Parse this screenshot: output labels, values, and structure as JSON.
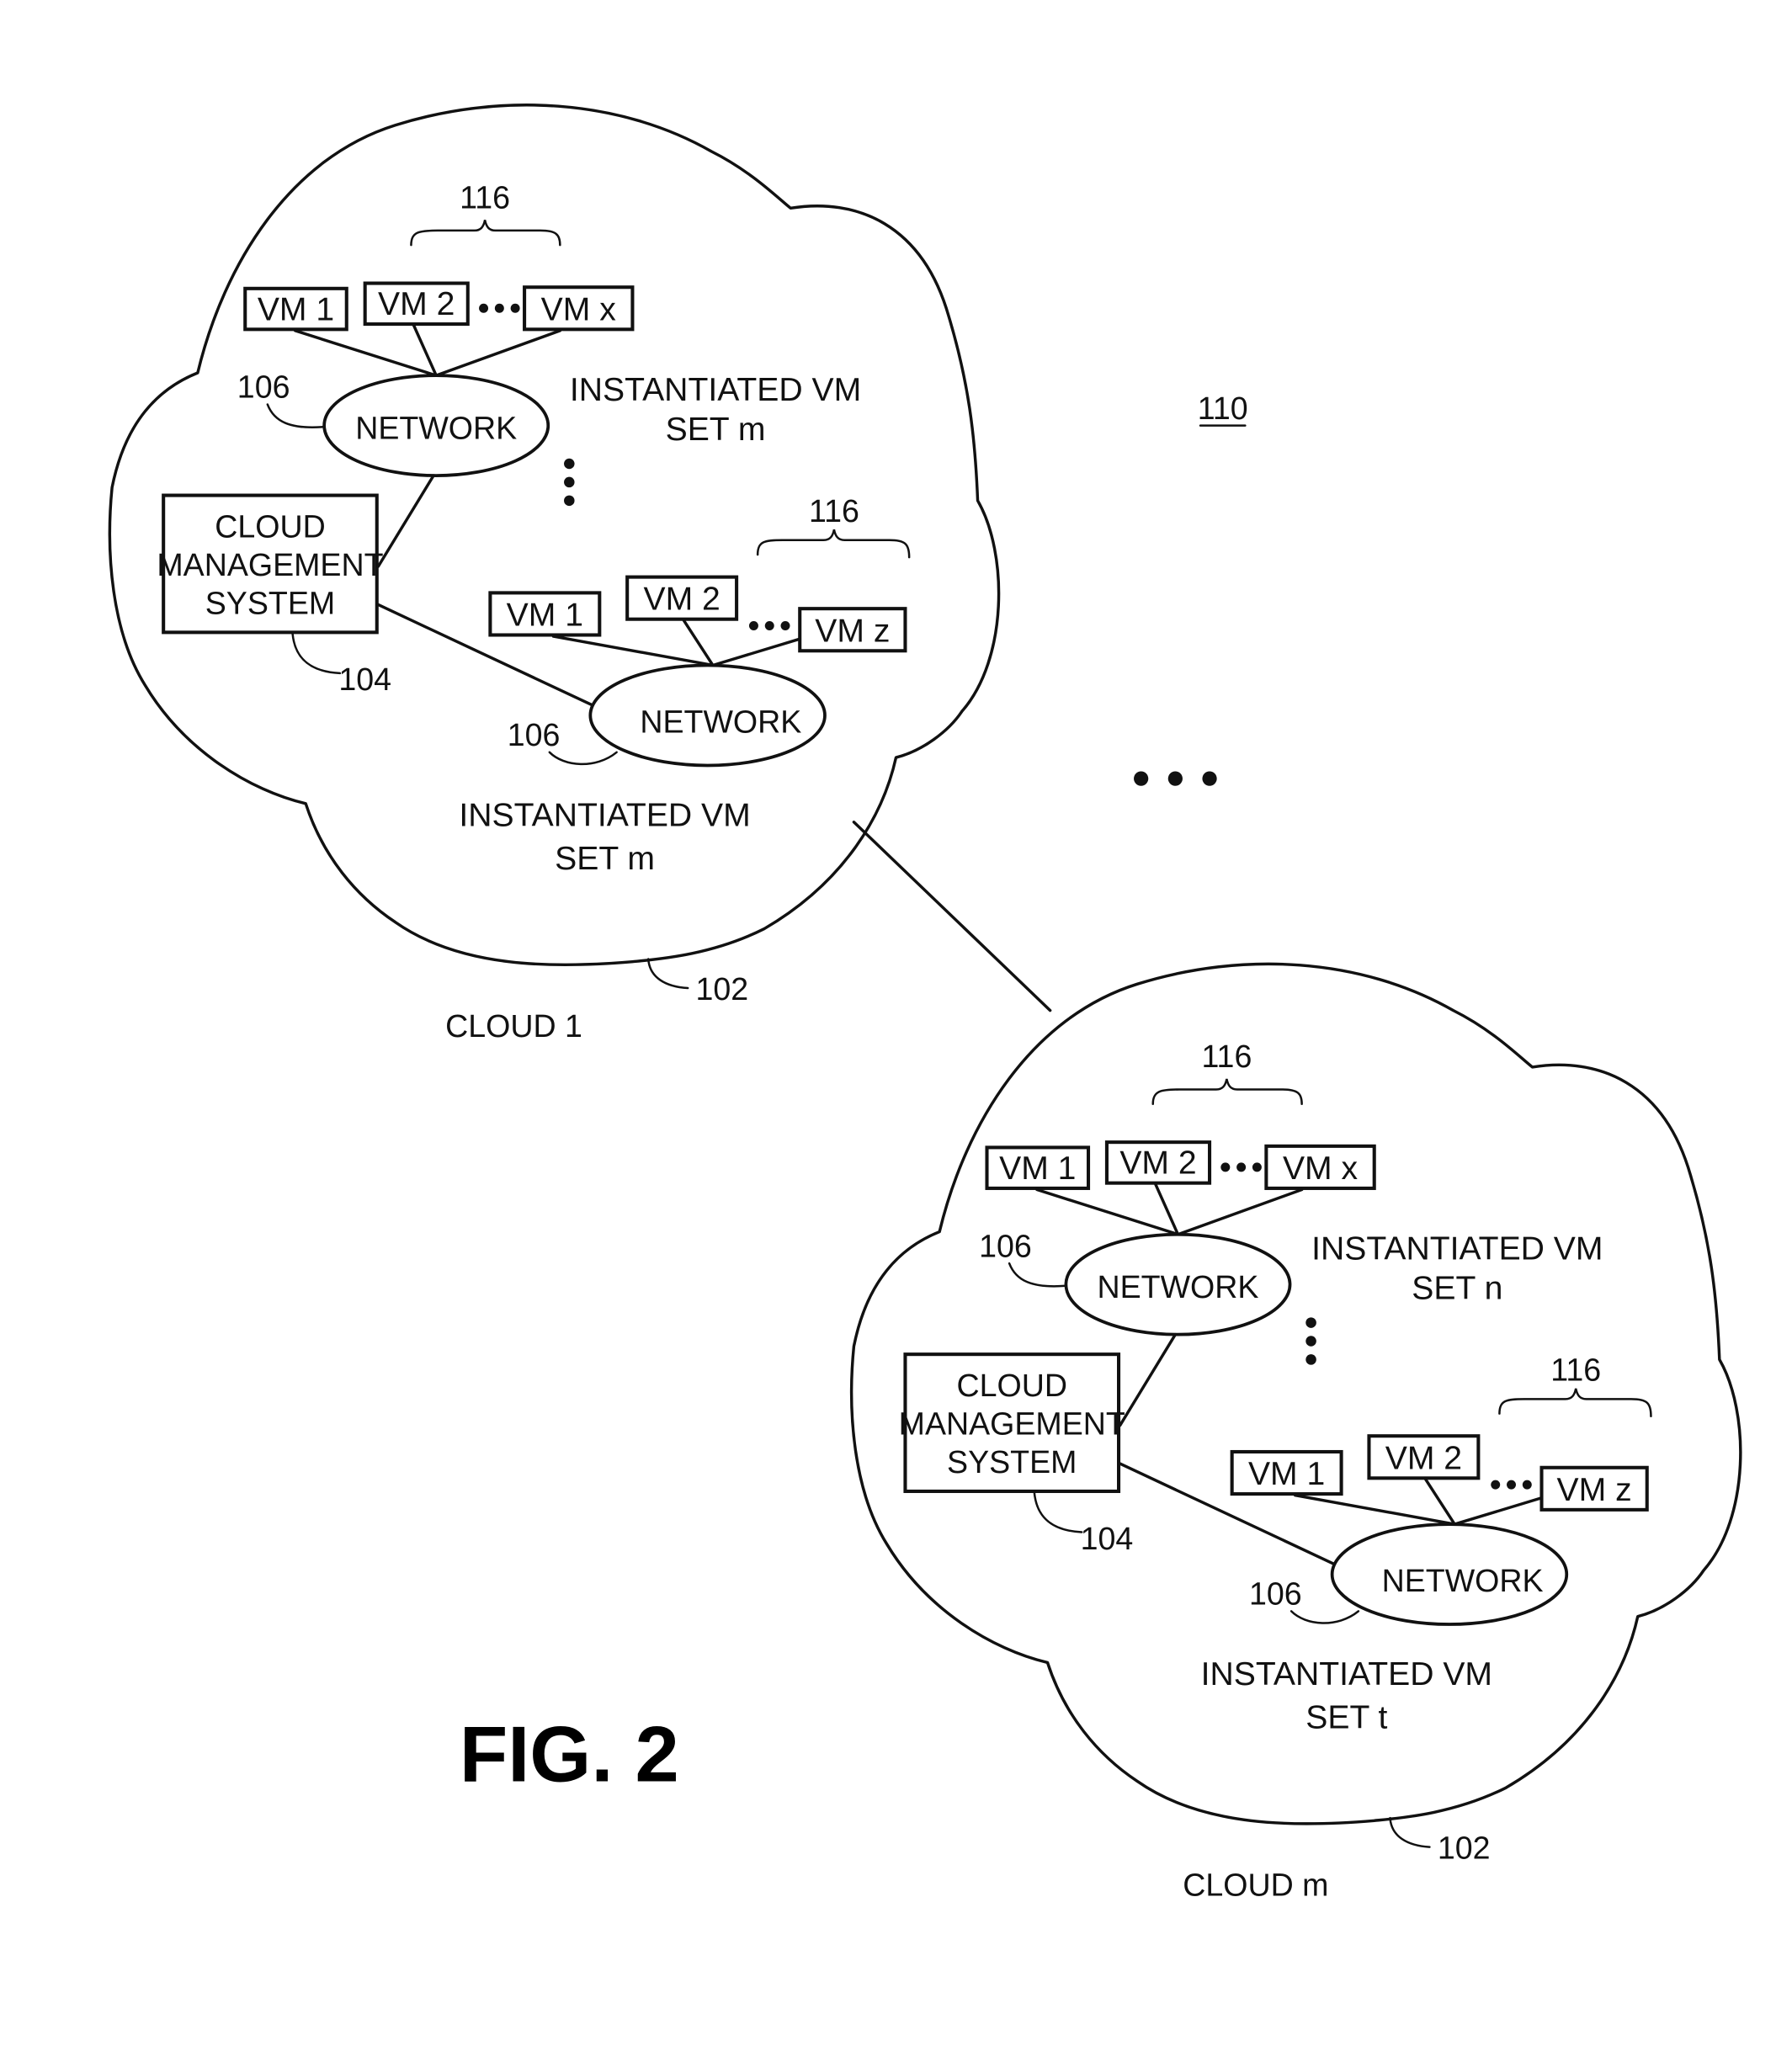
{
  "figure": {
    "label": "FIG. 2",
    "system_ref": "110",
    "connector_ellipsis": "• • •"
  },
  "clouds": [
    {
      "name": "CLOUD 1",
      "ref": "102",
      "cms": {
        "lines": [
          "CLOUD",
          "MANAGEMENT",
          "SYSTEM"
        ],
        "ref": "104"
      },
      "vm_sets": [
        {
          "set_label_line1": "INSTANTIATED VM",
          "set_label_line2": "SET m",
          "network_label": "NETWORK",
          "network_ref": "106",
          "vm_group_ref": "116",
          "vms": [
            "VM 1",
            "VM 2",
            "VM x"
          ]
        },
        {
          "set_label_line1": "INSTANTIATED VM",
          "set_label_line2": "SET m",
          "network_label": "NETWORK",
          "network_ref": "106",
          "vm_group_ref": "116",
          "vms": [
            "VM 1",
            "VM 2",
            "VM z"
          ]
        }
      ]
    },
    {
      "name": "CLOUD m",
      "ref": "102",
      "cms": {
        "lines": [
          "CLOUD",
          "MANAGEMENT",
          "SYSTEM"
        ],
        "ref": "104"
      },
      "vm_sets": [
        {
          "set_label_line1": "INSTANTIATED VM",
          "set_label_line2": "SET n",
          "network_label": "NETWORK",
          "network_ref": "106",
          "vm_group_ref": "116",
          "vms": [
            "VM 1",
            "VM 2",
            "VM x"
          ]
        },
        {
          "set_label_line1": "INSTANTIATED VM",
          "set_label_line2": "SET t",
          "network_label": "NETWORK",
          "network_ref": "106",
          "vm_group_ref": "116",
          "vms": [
            "VM 1",
            "VM 2",
            "VM z"
          ]
        }
      ]
    }
  ]
}
